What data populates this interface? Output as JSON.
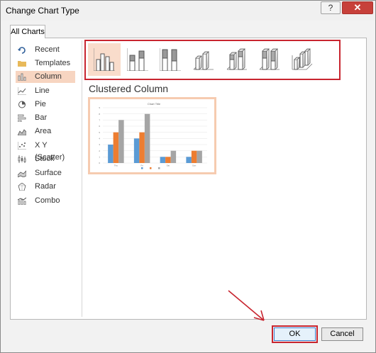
{
  "window": {
    "title": "Change Chart Type",
    "help_glyph": "?",
    "close_glyph": "✕"
  },
  "tabs": [
    {
      "label": "All Charts"
    }
  ],
  "sidebar": {
    "items": [
      {
        "label": "Recent",
        "icon": "recent-icon"
      },
      {
        "label": "Templates",
        "icon": "folder-icon"
      },
      {
        "label": "Column",
        "icon": "column-chart-icon",
        "selected": true
      },
      {
        "label": "Line",
        "icon": "line-chart-icon"
      },
      {
        "label": "Pie",
        "icon": "pie-chart-icon"
      },
      {
        "label": "Bar",
        "icon": "bar-chart-icon"
      },
      {
        "label": "Area",
        "icon": "area-chart-icon"
      },
      {
        "label": "X Y (Scatter)",
        "icon": "scatter-chart-icon"
      },
      {
        "label": "Stock",
        "icon": "stock-chart-icon"
      },
      {
        "label": "Surface",
        "icon": "surface-chart-icon"
      },
      {
        "label": "Radar",
        "icon": "radar-chart-icon"
      },
      {
        "label": "Combo",
        "icon": "combo-chart-icon"
      }
    ]
  },
  "subtypes": {
    "selected_title": "Clustered Column",
    "items": [
      {
        "icon": "clustered-column-icon",
        "selected": true
      },
      {
        "icon": "stacked-column-icon"
      },
      {
        "icon": "100-stacked-column-icon"
      },
      {
        "icon": "3d-clustered-column-icon"
      },
      {
        "icon": "3d-stacked-column-icon"
      },
      {
        "icon": "3d-100-stacked-column-icon"
      },
      {
        "icon": "3d-column-icon"
      }
    ]
  },
  "preview": {
    "chart_data": {
      "type": "bar",
      "title": "Chart Title",
      "categories": [
        "Thu",
        "Fri",
        "Sat",
        "Sun"
      ],
      "series": [
        {
          "values": [
            3,
            4,
            1,
            1
          ],
          "color": "#5b9bd5"
        },
        {
          "values": [
            5,
            5,
            1,
            2
          ],
          "color": "#ed7d31"
        },
        {
          "values": [
            7,
            8,
            2,
            2
          ],
          "color": "#a5a5a5"
        }
      ],
      "ylim": [
        0,
        9
      ],
      "yticks": [
        0,
        1,
        2,
        3,
        4,
        5,
        6,
        7,
        8,
        9
      ],
      "grid": true,
      "legend_position": "bottom"
    }
  },
  "buttons": {
    "ok": "OK",
    "cancel": "Cancel"
  },
  "colors": {
    "accent_red": "#c8252f",
    "selection": "#f7d5c1",
    "ok_border": "#3d7fcf"
  }
}
